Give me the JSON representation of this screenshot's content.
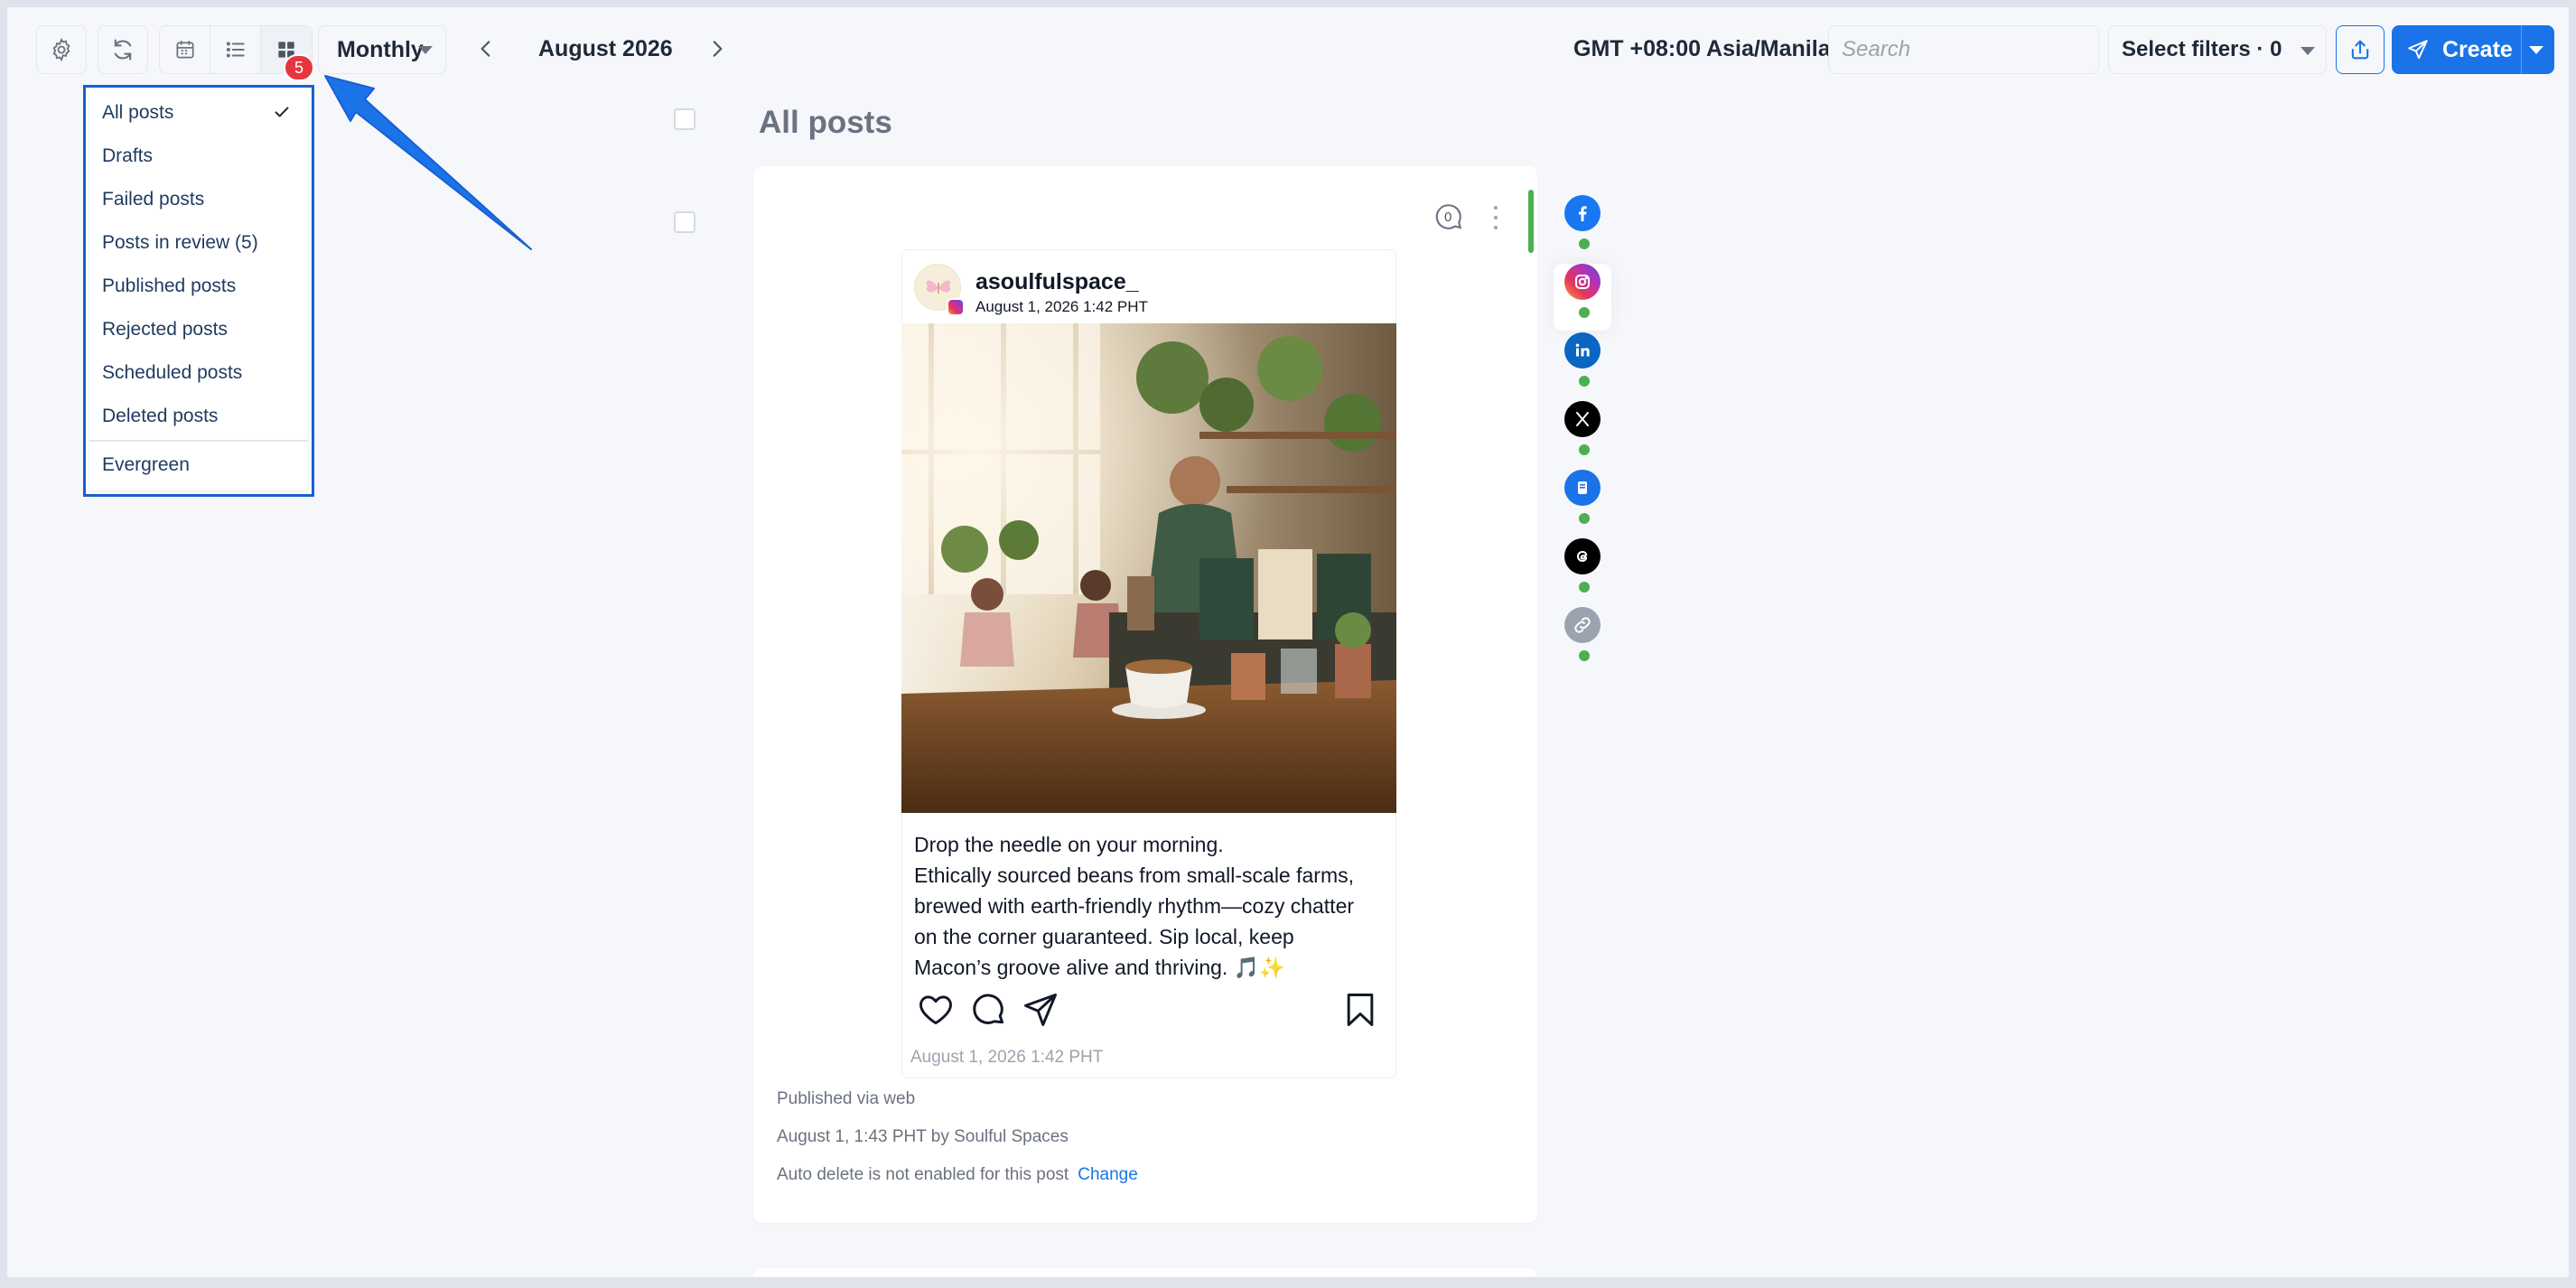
{
  "toolbar": {
    "view_select": "Monthly",
    "period": "August 2026",
    "badge_count": "5",
    "timezone": "GMT +08:00 Asia/Manila",
    "search_placeholder": "Search",
    "filters_label": "Select filters · 0",
    "create_label": "Create"
  },
  "dropdown": {
    "items": [
      {
        "label": "All posts",
        "selected": true
      },
      {
        "label": "Drafts"
      },
      {
        "label": "Failed posts"
      },
      {
        "label": "Posts in review (5)"
      },
      {
        "label": "Published posts"
      },
      {
        "label": "Rejected posts"
      },
      {
        "label": "Scheduled posts"
      },
      {
        "label": "Deleted posts"
      },
      {
        "label": "Evergreen"
      }
    ]
  },
  "main": {
    "title": "All posts",
    "post": {
      "comment_count": "0",
      "account_name": "asoulfulspace_",
      "account_time": "August 1, 2026 1:42 PHT",
      "caption_lines": [
        "Drop the needle on your morning.",
        "Ethically sourced beans from small-scale farms,",
        "brewed with earth-friendly rhythm—cozy chatter",
        "on the corner guaranteed. Sip local, keep",
        "Macon’s groove alive and thriving. 🎵✨"
      ],
      "footer_time": "August 1, 2026 1:42 PHT"
    },
    "meta": {
      "published_via": "Published via web",
      "published_by": "August 1, 1:43 PHT by Soulful Spaces",
      "auto_delete": "Auto delete is not enabled for this post",
      "change_link": "Change"
    }
  },
  "social_rail": [
    {
      "network": "facebook",
      "color": "#1877f2"
    },
    {
      "network": "instagram",
      "color": "#d6249f"
    },
    {
      "network": "linkedin",
      "color": "#0a66c2"
    },
    {
      "network": "x",
      "color": "#000000"
    },
    {
      "network": "google-business",
      "color": "#1a73e8"
    },
    {
      "network": "threads",
      "color": "#000000"
    },
    {
      "network": "link",
      "color": "#9ca3af"
    }
  ],
  "colors": {
    "accent": "#1a73e8",
    "badge": "#e5363f",
    "status_ok": "#4caf50"
  }
}
